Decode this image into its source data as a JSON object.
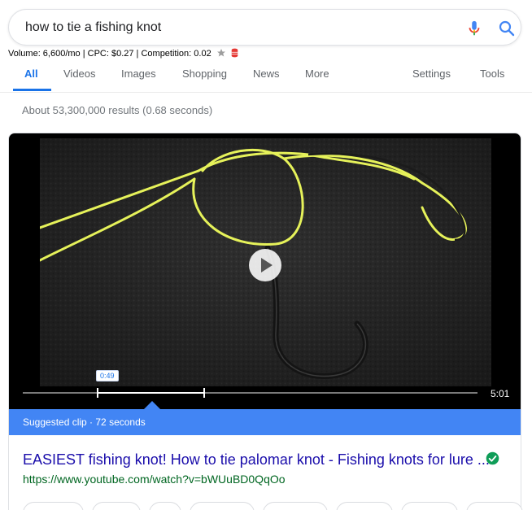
{
  "search": {
    "query": "how to tie a fishing knot"
  },
  "keyword_meta": {
    "text": "Volume: 6,600/mo | CPC: $0.27 | Competition: 0.02"
  },
  "tabs": [
    {
      "label": "All",
      "active": true
    },
    {
      "label": "Videos"
    },
    {
      "label": "Images"
    },
    {
      "label": "Shopping"
    },
    {
      "label": "News"
    },
    {
      "label": "More"
    },
    {
      "label": "Settings"
    },
    {
      "label": "Tools"
    }
  ],
  "results_stats": "About 53,300,000 results (0.68 seconds)",
  "video": {
    "clip_start": "0:49",
    "duration": "5:01",
    "suggested_clip": "Suggested clip · 72 seconds",
    "title": "EASIEST fishing knot! How to tie palomar knot - Fishing knots for lure ...",
    "url": "https://www.youtube.com/watch?v=bWUuBD0QqOo"
  },
  "colors": {
    "accent": "#1a73e8",
    "link": "#1a0dab",
    "url": "#006621",
    "clip_bar": "#4285f4",
    "line": "#e6f25a"
  },
  "icons": {
    "mic": "mic-icon",
    "search": "search-icon",
    "star": "star-icon",
    "db": "database-icon",
    "play": "play-icon",
    "verified": "check-circle-icon"
  }
}
